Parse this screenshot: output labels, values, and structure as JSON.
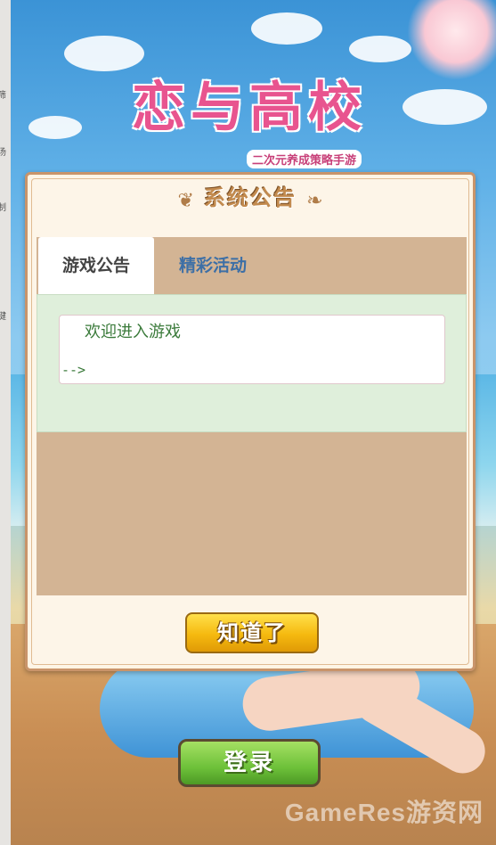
{
  "sidebar": {
    "clipped_chars": [
      "筛",
      "汤",
      "制",
      "键"
    ]
  },
  "game": {
    "logo_title": "恋与高校",
    "logo_subtitle": "二次元养成策略手游",
    "login_label": "登录",
    "watermark": "GameRes游资网"
  },
  "dialog": {
    "title": "系统公告",
    "tabs": [
      {
        "label": "游戏公告",
        "active": true
      },
      {
        "label": "精彩活动",
        "active": false
      }
    ],
    "notice_text": "欢迎进入游戏",
    "notice_tail": "-->",
    "ok_label": "知道了"
  },
  "colors": {
    "dialog_bg": "#fdf5e8",
    "panel_bg": "#d3b494",
    "content_bg": "#dfefdb",
    "tab_inactive_text": "#3d6fa6",
    "notice_text": "#3a7a3a",
    "ok_button": "#f5b90f",
    "login_button": "#6ec13a"
  }
}
